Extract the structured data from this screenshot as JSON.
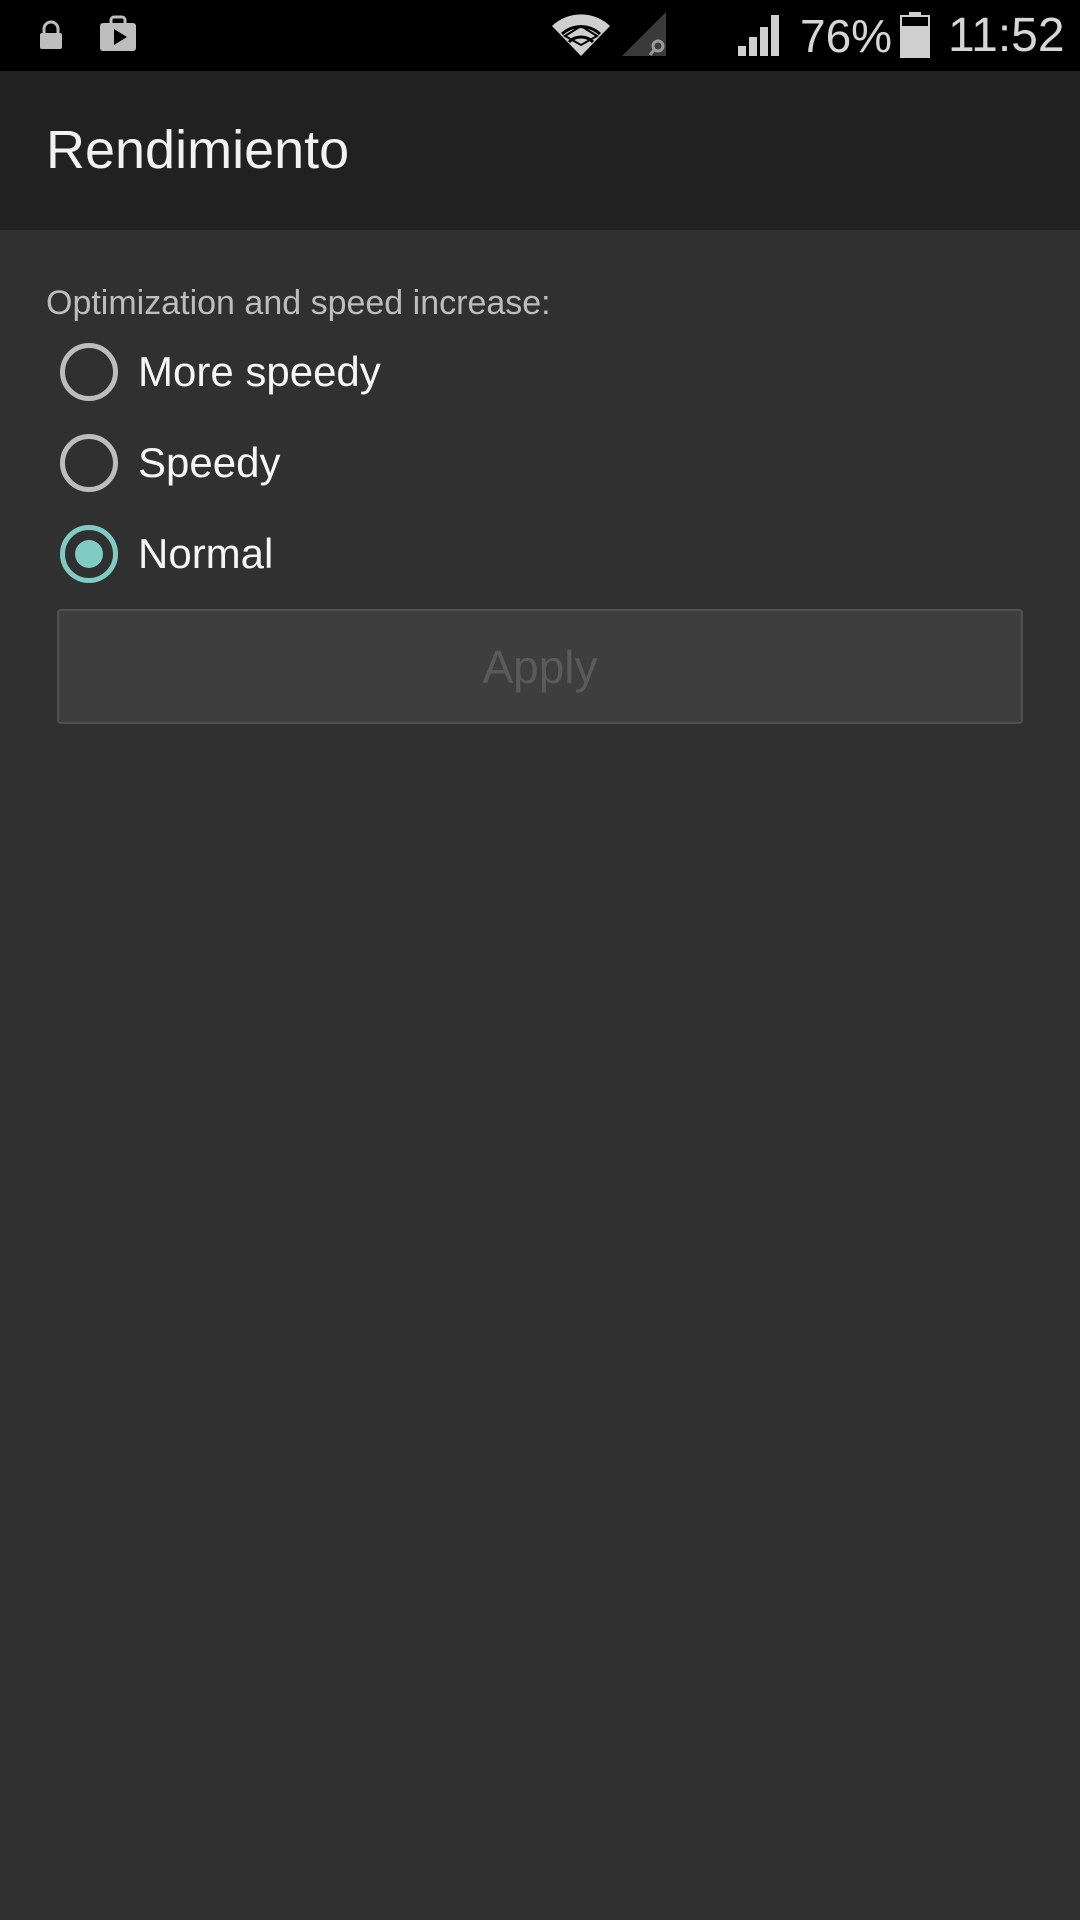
{
  "status_bar": {
    "battery_percent": "76%",
    "time": "11:52",
    "battery_level": 0.76,
    "icons": [
      "lock-icon",
      "play-store-icon",
      "wifi-icon",
      "signal-roaming-icon",
      "signal-icon",
      "battery-icon"
    ]
  },
  "action_bar": {
    "title": "Rendimiento"
  },
  "settings": {
    "section_label": "Optimization and speed increase:",
    "options": [
      {
        "label": "More speedy",
        "checked": false
      },
      {
        "label": "Speedy",
        "checked": false
      },
      {
        "label": "Normal",
        "checked": true
      }
    ],
    "apply_label": "Apply",
    "apply_enabled": false
  },
  "colors": {
    "accent": "#80cbc4",
    "background": "#303030",
    "action_bar": "#212121",
    "status_bar": "#000000"
  }
}
